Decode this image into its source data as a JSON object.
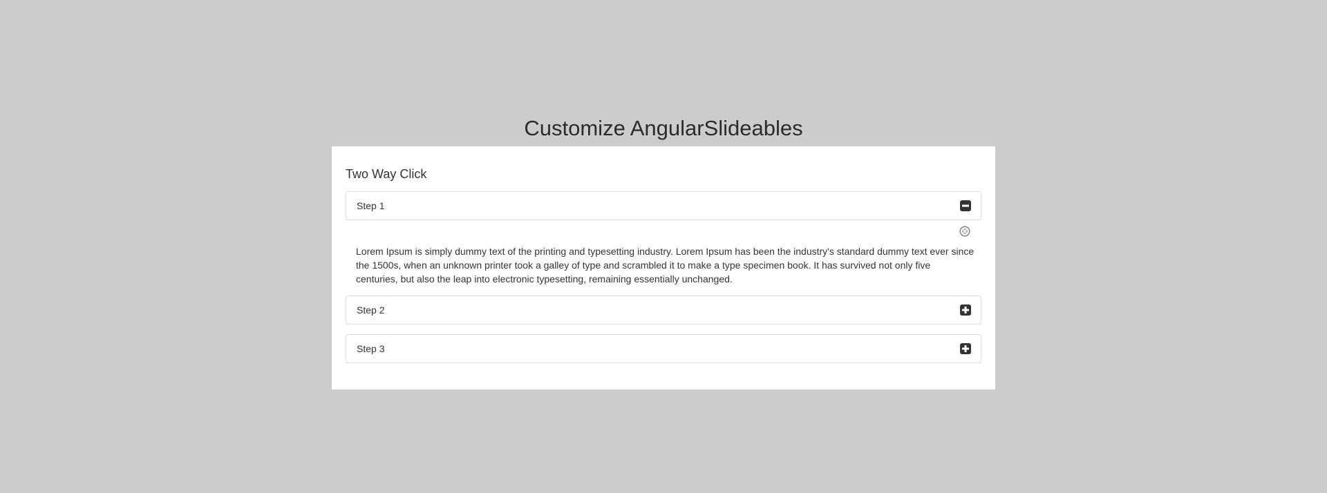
{
  "page": {
    "title": "Customize AngularSlideables"
  },
  "panel": {
    "heading": "Two Way Click",
    "steps": [
      {
        "label": "Step 1",
        "expanded": true,
        "toggle_icon": "minus-square-icon",
        "body": "Lorem Ipsum is simply dummy text of the printing and typesetting industry. Lorem Ipsum has been the industry's standard dummy text ever since the 1500s, when an unknown printer took a galley of type and scrambled it to make a type specimen book. It has survived not only five centuries, but also the leap into electronic typesetting, remaining essentially unchanged.",
        "close_icon": "close-circle-icon"
      },
      {
        "label": "Step 2",
        "expanded": false,
        "toggle_icon": "plus-square-icon"
      },
      {
        "label": "Step 3",
        "expanded": false,
        "toggle_icon": "plus-square-icon"
      }
    ]
  },
  "colors": {
    "background": "#cccccc",
    "panel": "#ffffff",
    "icon": "#333333",
    "close_icon": "#888888"
  }
}
